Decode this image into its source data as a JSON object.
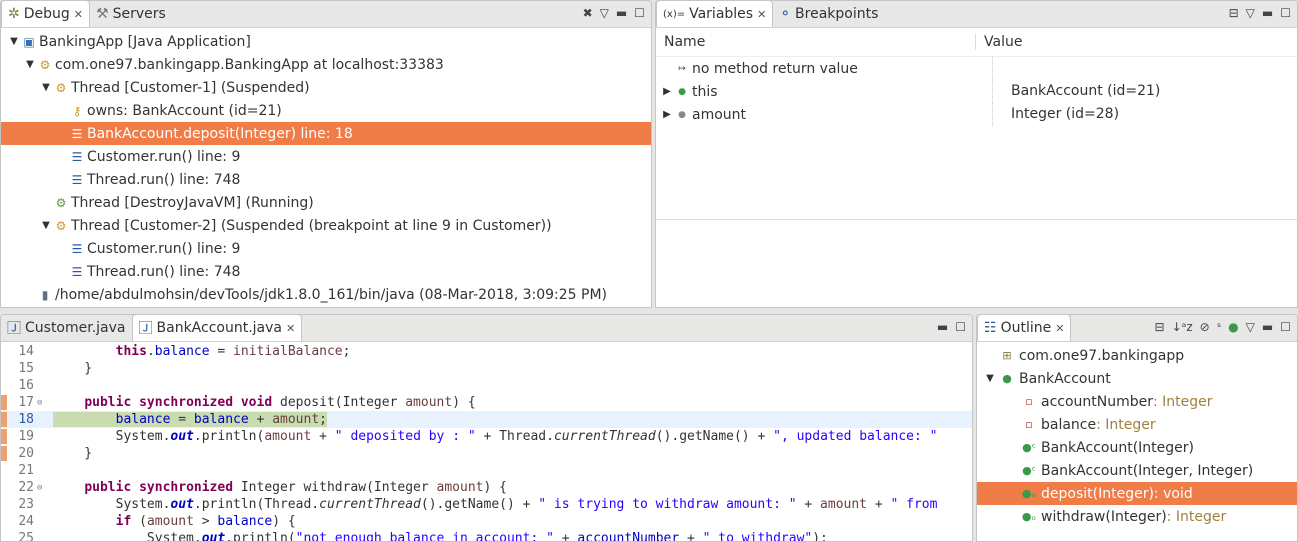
{
  "debug": {
    "tabs": [
      {
        "label": "Debug"
      },
      {
        "label": "Servers"
      }
    ],
    "tree": [
      {
        "depth": 0,
        "tri": "▼",
        "icon": "app-icon",
        "glyph": "▣",
        "color": "#3a6fb0",
        "label": "BankingApp [Java Application]"
      },
      {
        "depth": 1,
        "tri": "▼",
        "icon": "vm-icon",
        "glyph": "⚙",
        "color": "#c89a2a",
        "label": "com.one97.bankingapp.BankingApp at localhost:33383"
      },
      {
        "depth": 2,
        "tri": "▼",
        "icon": "thread-suspended-icon",
        "glyph": "⚙",
        "color": "#c89a2a",
        "label": "Thread [Customer-1] (Suspended)"
      },
      {
        "depth": 3,
        "tri": "",
        "icon": "monitor-key-icon",
        "glyph": "⚷",
        "color": "#c8a020",
        "label": "owns: BankAccount  (id=21)"
      },
      {
        "depth": 3,
        "tri": "",
        "icon": "stack-frame-icon",
        "glyph": "☰",
        "color": "#2c5a9c",
        "label": "BankAccount.deposit(Integer) line: 18",
        "selected": true
      },
      {
        "depth": 3,
        "tri": "",
        "icon": "stack-frame-icon",
        "glyph": "☰",
        "color": "#2c5a9c",
        "label": "Customer.run() line: 9"
      },
      {
        "depth": 3,
        "tri": "",
        "icon": "stack-frame-icon",
        "glyph": "☰",
        "color": "#2c5a9c",
        "label": "Thread.run() line: 748"
      },
      {
        "depth": 2,
        "tri": "",
        "icon": "thread-running-icon",
        "glyph": "⚙",
        "color": "#5a9a2a",
        "label": "Thread [DestroyJavaVM] (Running)"
      },
      {
        "depth": 2,
        "tri": "▼",
        "icon": "thread-suspended-icon",
        "glyph": "⚙",
        "color": "#c89a2a",
        "label": "Thread [Customer-2] (Suspended (breakpoint at line 9 in Customer))"
      },
      {
        "depth": 3,
        "tri": "",
        "icon": "stack-frame-icon",
        "glyph": "☰",
        "color": "#2c5a9c",
        "label": "Customer.run() line: 9"
      },
      {
        "depth": 3,
        "tri": "",
        "icon": "stack-frame-icon",
        "glyph": "☰",
        "color": "#2c5a9c",
        "label": "Thread.run() line: 748"
      },
      {
        "depth": 1,
        "tri": "",
        "icon": "process-icon",
        "glyph": "▮",
        "color": "#607080",
        "label": "/home/abdulmohsin/devTools/jdk1.8.0_161/bin/java (08-Mar-2018, 3:09:25 PM)"
      }
    ]
  },
  "variables": {
    "tabs": [
      {
        "label": "Variables"
      },
      {
        "label": "Breakpoints"
      }
    ],
    "columns": {
      "name": "Name",
      "value": "Value"
    },
    "rows": [
      {
        "tri": "",
        "glyph": "↦",
        "color": "#444",
        "name": "no method return value",
        "value": ""
      },
      {
        "tri": "▶",
        "glyph": "●",
        "color": "#3a9a4a",
        "name": "this",
        "value": "BankAccount  (id=21)"
      },
      {
        "tri": "▶",
        "glyph": "●",
        "color": "#888",
        "name": "amount",
        "value": "Integer  (id=28)"
      }
    ]
  },
  "editor": {
    "tabs": [
      {
        "label": "Customer.java"
      },
      {
        "label": "BankAccount.java"
      }
    ],
    "current_line": 18,
    "lines": [
      {
        "n": "14",
        "t": [
          [
            "",
            "        "
          ],
          [
            "kw",
            "this"
          ],
          [
            "",
            "."
          ],
          [
            "fd",
            "balance"
          ],
          [
            "",
            " = "
          ],
          [
            "pm",
            "initialBalance"
          ],
          [
            "",
            ";"
          ]
        ]
      },
      {
        "n": "15",
        "t": [
          [
            "",
            "    }"
          ]
        ]
      },
      {
        "n": "16",
        "t": []
      },
      {
        "n": "17",
        "fold": true,
        "t": [
          [
            "",
            "    "
          ],
          [
            "kw",
            "public"
          ],
          [
            "",
            " "
          ],
          [
            "kw",
            "synchronized"
          ],
          [
            "",
            " "
          ],
          [
            "kw",
            "void"
          ],
          [
            "",
            " deposit(Integer "
          ],
          [
            "pm",
            "amount"
          ],
          [
            "",
            ") {"
          ]
        ]
      },
      {
        "n": "18",
        "cur": true,
        "t": [
          [
            "",
            "        "
          ],
          [
            "fd",
            "balance"
          ],
          [
            "",
            " = "
          ],
          [
            "fd",
            "balance"
          ],
          [
            "",
            " + "
          ],
          [
            "pm",
            "amount"
          ],
          [
            "",
            ";"
          ]
        ]
      },
      {
        "n": "19",
        "t": [
          [
            "",
            "        System."
          ],
          [
            "sf",
            "out"
          ],
          [
            "",
            ".println("
          ],
          [
            "pm",
            "amount"
          ],
          [
            "",
            " + "
          ],
          [
            "st",
            "\" deposited by : \""
          ],
          [
            "",
            " + Thread."
          ],
          [
            "it",
            "currentThread"
          ],
          [
            "",
            "().getName() + "
          ],
          [
            "st",
            "\", updated balance: \""
          ]
        ]
      },
      {
        "n": "20",
        "t": [
          [
            "",
            "    }"
          ]
        ]
      },
      {
        "n": "21",
        "t": []
      },
      {
        "n": "22",
        "fold": true,
        "t": [
          [
            "",
            "    "
          ],
          [
            "kw",
            "public"
          ],
          [
            "",
            " "
          ],
          [
            "kw",
            "synchronized"
          ],
          [
            "",
            " Integer withdraw(Integer "
          ],
          [
            "pm",
            "amount"
          ],
          [
            "",
            ") {"
          ]
        ]
      },
      {
        "n": "23",
        "t": [
          [
            "",
            "        System."
          ],
          [
            "sf",
            "out"
          ],
          [
            "",
            ".println(Thread."
          ],
          [
            "it",
            "currentThread"
          ],
          [
            "",
            "().getName() + "
          ],
          [
            "st",
            "\" is trying to withdraw amount: \""
          ],
          [
            "",
            " + "
          ],
          [
            "pm",
            "amount"
          ],
          [
            "",
            " + "
          ],
          [
            "st",
            "\" from"
          ]
        ]
      },
      {
        "n": "24",
        "t": [
          [
            "",
            "        "
          ],
          [
            "kw",
            "if"
          ],
          [
            "",
            " ("
          ],
          [
            "pm",
            "amount"
          ],
          [
            "",
            " > "
          ],
          [
            "fd",
            "balance"
          ],
          [
            "",
            ") {"
          ]
        ]
      },
      {
        "n": "25",
        "t": [
          [
            "",
            "            System."
          ],
          [
            "sf",
            "out"
          ],
          [
            "",
            ".println("
          ],
          [
            "st",
            "\"not enough balance in account: \""
          ],
          [
            "",
            " + "
          ],
          [
            "fd",
            "accountNumber"
          ],
          [
            "",
            " + "
          ],
          [
            "st",
            "\" to withdraw\""
          ],
          [
            "",
            ");"
          ]
        ]
      }
    ]
  },
  "outline": {
    "tab": "Outline",
    "items": [
      {
        "depth": 0,
        "tri": "",
        "glyph": "⊞",
        "color": "#8a7a40",
        "label": "com.one97.bankingapp",
        "type": ""
      },
      {
        "depth": 0,
        "tri": "▼",
        "glyph": "●",
        "color": "#3a9a4a",
        "label": "BankAccount",
        "type": ""
      },
      {
        "depth": 1,
        "tri": "",
        "glyph": "▫",
        "color": "#c03030",
        "label": "accountNumber",
        "type": " : Integer"
      },
      {
        "depth": 1,
        "tri": "",
        "glyph": "▫",
        "color": "#c03030",
        "label": "balance",
        "type": " : Integer"
      },
      {
        "depth": 1,
        "tri": "",
        "glyph": "●ᶜ",
        "color": "#3a9a4a",
        "label": "BankAccount(Integer)",
        "type": ""
      },
      {
        "depth": 1,
        "tri": "",
        "glyph": "●ᶜ",
        "color": "#3a9a4a",
        "label": "BankAccount(Integer, Integer)",
        "type": ""
      },
      {
        "depth": 1,
        "tri": "",
        "glyph": "●ₒ",
        "color": "#3a9a4a",
        "label": "deposit(Integer)",
        "type": " : void",
        "selected": true
      },
      {
        "depth": 1,
        "tri": "",
        "glyph": "●ₒ",
        "color": "#3a9a4a",
        "label": "withdraw(Integer)",
        "type": " : Integer"
      }
    ]
  }
}
